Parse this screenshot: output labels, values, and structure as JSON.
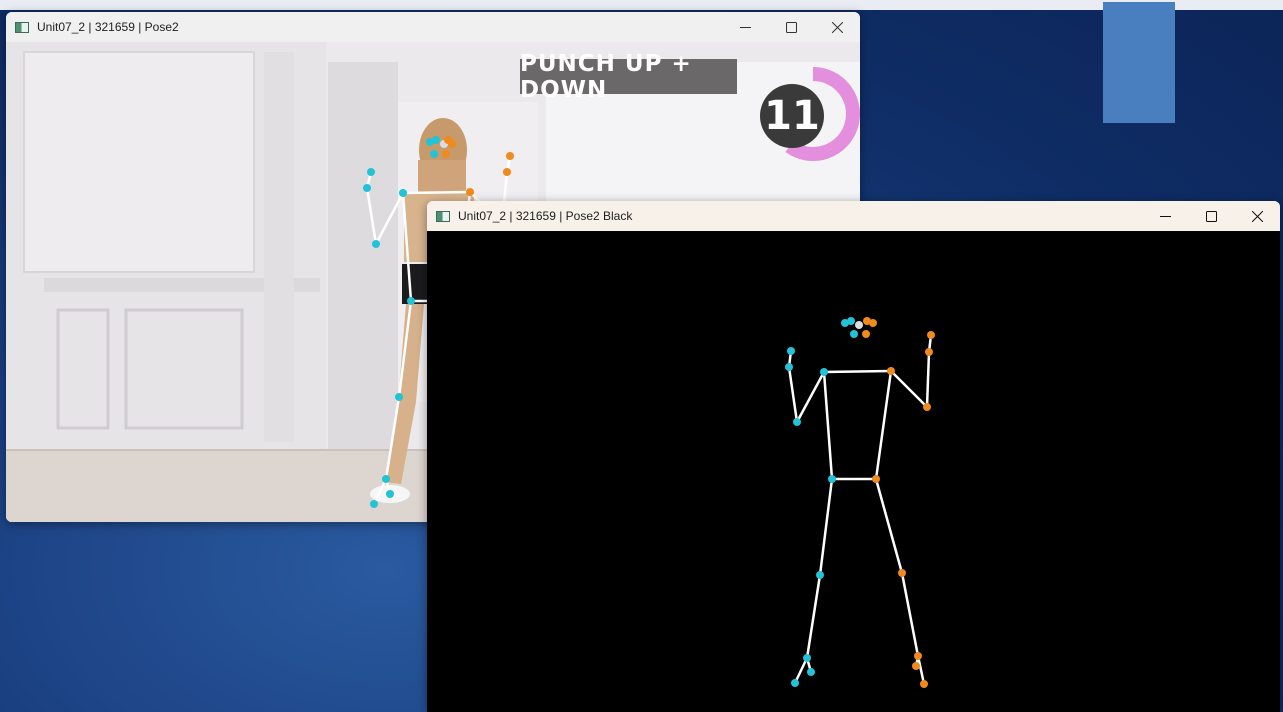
{
  "windows": [
    {
      "title": "Unit07_2 | 321659 | Pose2",
      "overlay_label": "PUNCH UP + DOWN",
      "rep_counter": "11",
      "rep_progress_fraction": 0.6
    },
    {
      "title": "Unit07_2 | 321659 | Pose2 Black"
    }
  ],
  "controls": {
    "minimize": "—",
    "maximize": "☐",
    "close": "✕"
  },
  "colors": {
    "left_keypoint": "#22c3d6",
    "right_keypoint": "#f08a1c",
    "skeleton_line": "#ffffff",
    "counter_ring": "#e38fdd",
    "desktop_tile": "#4a7fbf"
  },
  "icons": [
    "app-window-icon",
    "minimize-icon",
    "maximize-icon",
    "close-icon"
  ]
}
